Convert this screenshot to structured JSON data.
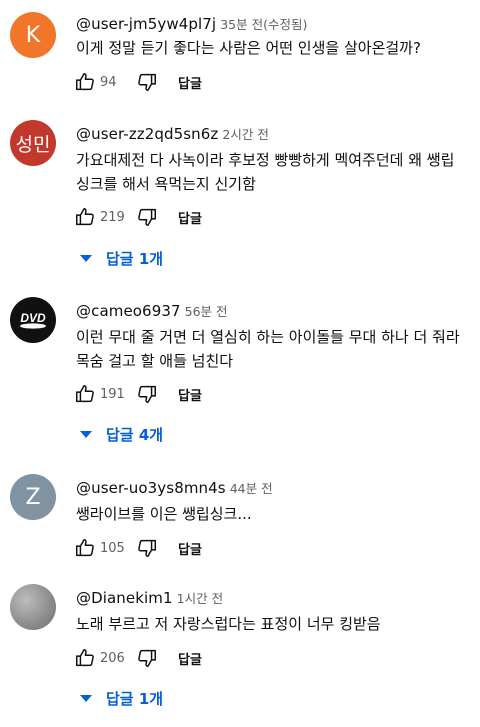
{
  "icons": {
    "like": "thumbs-up-icon",
    "dislike": "thumbs-down-icon",
    "expand": "caret-down-icon"
  },
  "colors": {
    "link_blue": "#065fd4",
    "secondary_text": "#606060"
  },
  "comments": [
    {
      "avatar_letter": "K",
      "handle": "@user-jm5yw4pl7j",
      "time": "35분 전(수정됨)",
      "text": "이게 정말 듣기 좋다는 사람은 어떤 인생을 살아온걸까?",
      "likes": "94",
      "reply_label": "답글"
    },
    {
      "avatar_letter": "성민",
      "handle": "@user-zz2qd5sn6z",
      "time": "2시간 전",
      "text": "가요대제전 다 사녹이라 후보정 빵빵하게 멕여주던데 왜 쌩립싱크를 해서 욕먹는지 신기함",
      "likes": "219",
      "reply_label": "답글",
      "replies_label": "답글 1개"
    },
    {
      "avatar_letter": "DVD",
      "handle": "@cameo6937",
      "time": "56분 전",
      "text": "이런 무대 줄 거면 더 열심히 하는 아이돌들 무대 하나 더 줘라 목숨 걸고 할 애들 넘친다",
      "likes": "191",
      "reply_label": "답글",
      "replies_label": "답글 4개"
    },
    {
      "avatar_letter": "Z",
      "handle": "@user-uo3ys8mn4s",
      "time": "44분 전",
      "text": "쌩라이브를 이은 쌩립싱크...",
      "likes": "105",
      "reply_label": "답글"
    },
    {
      "handle": "@Dianekim1",
      "time": "1시간 전",
      "text": "노래 부르고 저 자랑스럽다는 표정이 너무 킹받음",
      "likes": "206",
      "reply_label": "답글",
      "replies_label": "답글 1개"
    }
  ]
}
